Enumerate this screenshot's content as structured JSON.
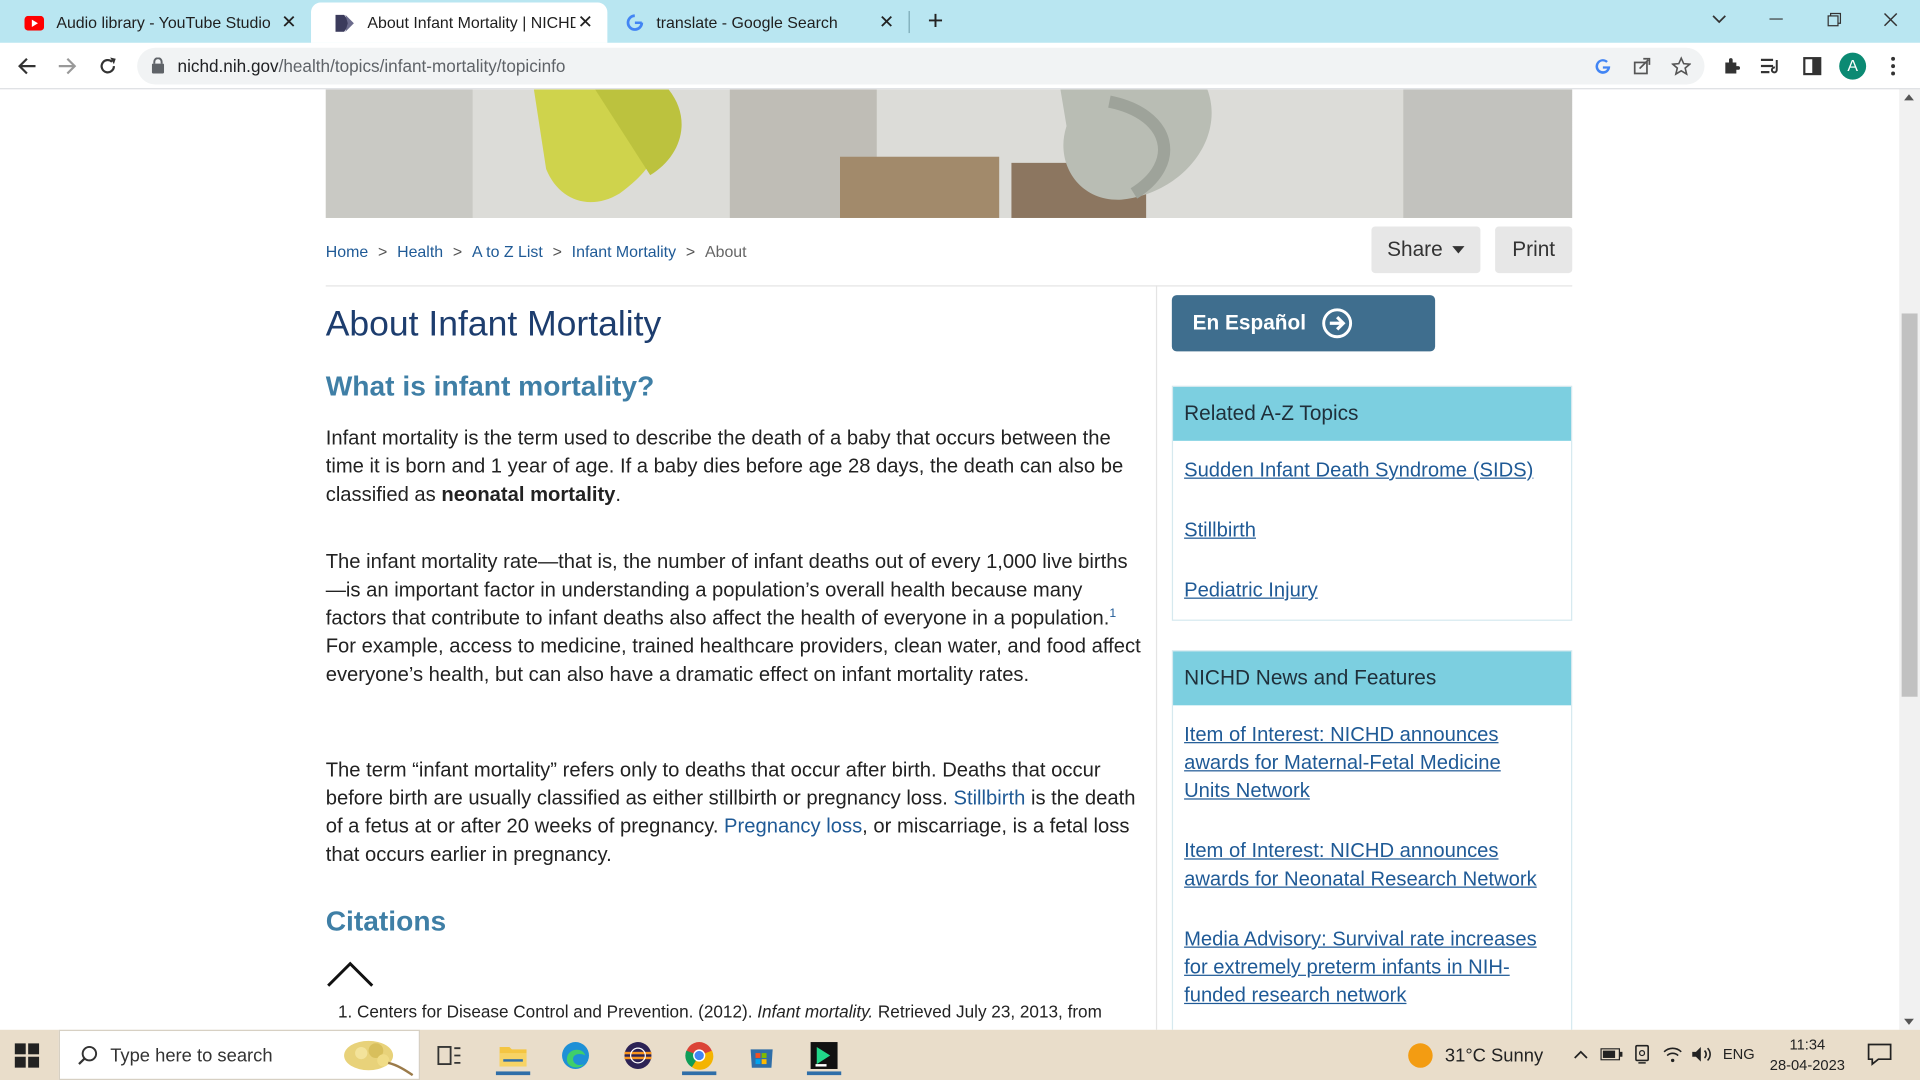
{
  "browser": {
    "tabs": [
      {
        "title": "Audio library - YouTube Studio",
        "favicon": "youtube-icon",
        "active": false
      },
      {
        "title": "About Infant Mortality | NICHD -",
        "favicon": "nichd-icon",
        "active": true
      },
      {
        "title": "translate - Google Search",
        "favicon": "google-icon",
        "active": false
      }
    ],
    "url_host": "nichd.nih.gov",
    "url_path": "/health/topics/infant-mortality/topicinfo",
    "profile_initial": "A"
  },
  "page": {
    "breadcrumb": [
      "Home",
      "Health",
      "A to Z List",
      "Infant Mortality"
    ],
    "breadcrumb_current": "About",
    "share_label": "Share",
    "print_label": "Print",
    "title": "About Infant Mortality",
    "subtitle": "What is infant mortality?",
    "p1_text": "Infant mortality is the term used to describe the death of a baby that occurs between the time it is born and 1 year of age. If a baby dies before age 28 days, the death can also be classified as ",
    "p1_bold": "neonatal mortality",
    "p1_end": ".",
    "p2_text": "The infant mortality rate—that is, the number of infant deaths out of every 1,000 live births—is an important factor in understanding a population’s overall health because many factors that contribute to infant deaths also affect the health of everyone in a population.",
    "p2_sup": "1",
    "p2_end": " For example, access to medicine, trained healthcare providers, clean water, and food affect everyone’s health, but can also have a dramatic effect on infant mortality rates.",
    "p3_a": "The term “infant mortality” refers only to deaths that occur after birth. Deaths that occur before birth are usually classified as either stillbirth or pregnancy loss. ",
    "p3_link1": "Stillbirth",
    "p3_b": " is the death of a fetus at or after 20 weeks of pregnancy. ",
    "p3_link2": "Pregnancy loss",
    "p3_c": ", or miscarriage, is a fetal loss that occurs earlier in pregnancy.",
    "citations_heading": "Citations",
    "citation_1_a": "1. Centers for Disease Control and Prevention. (2012). ",
    "citation_1_i": "Infant mortality.",
    "citation_1_b": " Retrieved July 23, 2013, from"
  },
  "sidebar": {
    "espanol_label": "En Español",
    "related_heading": "Related A-Z Topics",
    "related_links": [
      "Sudden Infant Death Syndrome (SIDS)",
      "Stillbirth",
      "Pediatric Injury"
    ],
    "news_heading": "NICHD News and Features",
    "news_links": [
      "Item of Interest: NICHD announces awards for Maternal-Fetal Medicine Units Network",
      "Item of Interest: NICHD announces awards for Neonatal Research Network",
      "Media Advisory: Survival rate increases for extremely preterm infants in NIH-funded research network"
    ]
  },
  "taskbar": {
    "search_placeholder": "Type here to search",
    "weather": "31°C  Sunny",
    "language": "ENG",
    "time": "11:34",
    "date": "28-04-2023"
  },
  "colors": {
    "heading": "#1d3d6e",
    "subheading": "#3f7fa6",
    "link": "#1f5a96",
    "sidebar_header": "#7ccfe0",
    "espanol_button": "#3f6e8e",
    "tabstrip": "#b9e6f1"
  }
}
